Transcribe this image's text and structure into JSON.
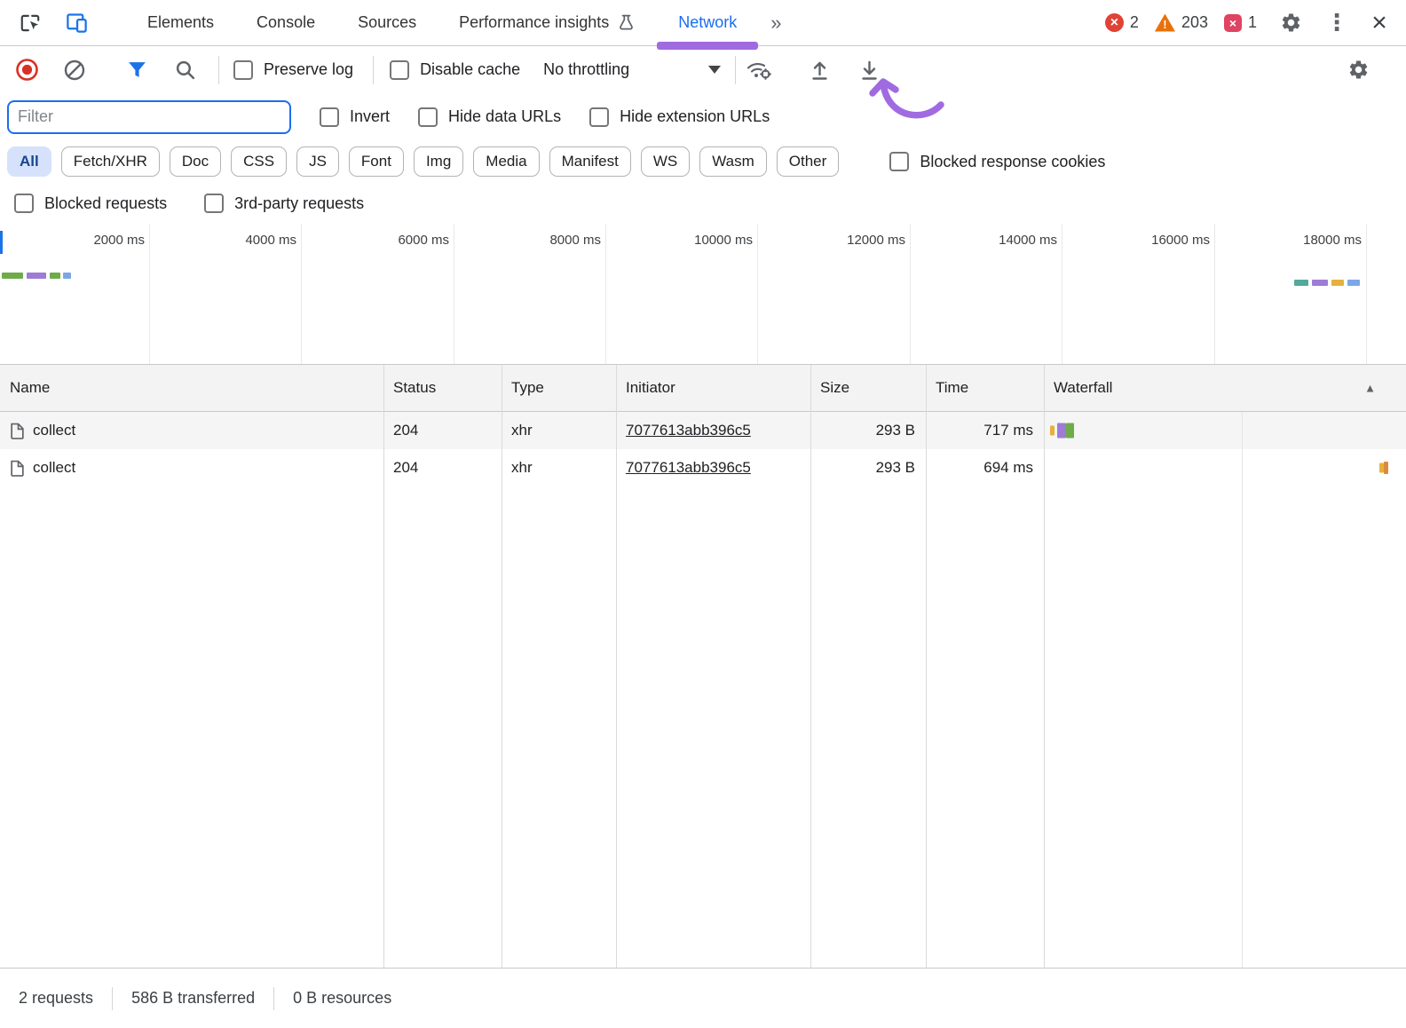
{
  "tabbar": {
    "tabs": [
      {
        "label": "Elements"
      },
      {
        "label": "Console"
      },
      {
        "label": "Sources"
      },
      {
        "label": "Performance insights"
      },
      {
        "label": "Network"
      }
    ],
    "active_tab": "Network",
    "error_count": "2",
    "warning_count": "203",
    "issue_count": "1"
  },
  "toolbar": {
    "preserve_log": "Preserve log",
    "disable_cache": "Disable cache",
    "throttling": "No throttling"
  },
  "filters": {
    "placeholder": "Filter",
    "invert": "Invert",
    "hide_data_urls": "Hide data URLs",
    "hide_extension_urls": "Hide extension URLs",
    "chips": [
      "All",
      "Fetch/XHR",
      "Doc",
      "CSS",
      "JS",
      "Font",
      "Img",
      "Media",
      "Manifest",
      "WS",
      "Wasm",
      "Other"
    ],
    "active_chip": "All",
    "blocked_response_cookies": "Blocked response cookies",
    "blocked_requests": "Blocked requests",
    "third_party_requests": "3rd-party requests"
  },
  "overview": {
    "ticks": [
      "2000 ms",
      "4000 ms",
      "6000 ms",
      "8000 ms",
      "10000 ms",
      "12000 ms",
      "14000 ms",
      "16000 ms",
      "18000 ms"
    ]
  },
  "table": {
    "columns": [
      "Name",
      "Status",
      "Type",
      "Initiator",
      "Size",
      "Time",
      "Waterfall"
    ],
    "rows": [
      {
        "name": "collect",
        "status": "204",
        "type": "xhr",
        "initiator": "7077613abb396c5",
        "size": "293 B",
        "time": "717 ms"
      },
      {
        "name": "collect",
        "status": "204",
        "type": "xhr",
        "initiator": "7077613abb396c5",
        "size": "293 B",
        "time": "694 ms"
      }
    ]
  },
  "statusbar": {
    "requests": "2 requests",
    "transferred": "586 B transferred",
    "resources": "0 B resources"
  },
  "icons": {
    "more_tabs": "»",
    "kebab_menu": "⋮",
    "close": "×",
    "sort_ascending": "▲"
  },
  "colors": {
    "accent_blue": "#1a73e8",
    "annotation_purple": "#a06be0",
    "error_red": "#e04235",
    "warning_orange": "#e8710a",
    "waterfall_green": "#6eac49",
    "waterfall_purple": "#9e7cd6",
    "waterfall_yellow": "#e5b13c",
    "waterfall_blue": "#7ba7e8",
    "waterfall_teal": "#53a99c"
  }
}
